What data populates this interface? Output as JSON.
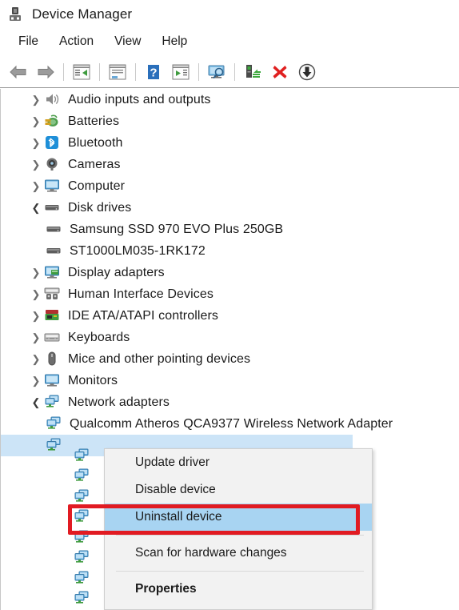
{
  "window": {
    "title": "Device Manager",
    "icon": "device-manager-icon"
  },
  "menubar": {
    "items": [
      {
        "label": "File",
        "name": "menu-file"
      },
      {
        "label": "Action",
        "name": "menu-action"
      },
      {
        "label": "View",
        "name": "menu-view"
      },
      {
        "label": "Help",
        "name": "menu-help"
      }
    ]
  },
  "toolbar": {
    "buttons": [
      {
        "name": "back-button",
        "icon": "back-arrow-icon"
      },
      {
        "name": "forward-button",
        "icon": "forward-arrow-icon"
      },
      {
        "name": "show-hide-console-tree-button",
        "icon": "console-tree-icon"
      },
      {
        "name": "properties-button",
        "icon": "properties-window-icon"
      },
      {
        "name": "help-button",
        "icon": "question-mark-icon"
      },
      {
        "name": "update-driver-button",
        "icon": "play-panel-icon"
      },
      {
        "name": "scan-for-hardware-changes-button",
        "icon": "monitor-scan-icon"
      },
      {
        "name": "add-legacy-hardware-button",
        "icon": "add-hardware-icon"
      },
      {
        "name": "uninstall-device-button",
        "icon": "red-x-icon"
      },
      {
        "name": "disable-device-button",
        "icon": "down-arrow-circle-icon"
      }
    ]
  },
  "tree": {
    "items": [
      {
        "label": "Audio inputs and outputs",
        "icon": "speaker-icon",
        "state": "collapsed",
        "level": 1
      },
      {
        "label": "Batteries",
        "icon": "battery-icon",
        "state": "collapsed",
        "level": 1
      },
      {
        "label": "Bluetooth",
        "icon": "bluetooth-icon",
        "state": "collapsed",
        "level": 1
      },
      {
        "label": "Cameras",
        "icon": "camera-icon",
        "state": "collapsed",
        "level": 1
      },
      {
        "label": "Computer",
        "icon": "computer-icon",
        "state": "collapsed",
        "level": 1
      },
      {
        "label": "Disk drives",
        "icon": "disk-drive-icon",
        "state": "expanded",
        "level": 1
      },
      {
        "label": "Samsung SSD 970 EVO Plus 250GB",
        "icon": "disk-drive-icon",
        "state": "leaf",
        "level": 2
      },
      {
        "label": "ST1000LM035-1RK172",
        "icon": "disk-drive-icon",
        "state": "leaf",
        "level": 2
      },
      {
        "label": "Display adapters",
        "icon": "display-adapter-icon",
        "state": "collapsed",
        "level": 1
      },
      {
        "label": "Human Interface Devices",
        "icon": "hid-icon",
        "state": "collapsed",
        "level": 1
      },
      {
        "label": "IDE ATA/ATAPI controllers",
        "icon": "ide-controller-icon",
        "state": "collapsed",
        "level": 1
      },
      {
        "label": "Keyboards",
        "icon": "keyboard-icon",
        "state": "collapsed",
        "level": 1
      },
      {
        "label": "Mice and other pointing devices",
        "icon": "mouse-icon",
        "state": "collapsed",
        "level": 1
      },
      {
        "label": "Monitors",
        "icon": "monitor-icon",
        "state": "collapsed",
        "level": 1
      },
      {
        "label": "Network adapters",
        "icon": "network-adapter-icon",
        "state": "expanded",
        "level": 1
      },
      {
        "label": "Qualcomm Atheros QCA9377 Wireless Network Adapter",
        "icon": "network-adapter-icon",
        "state": "leaf",
        "level": 2
      }
    ],
    "selected_row": {
      "label": "",
      "icon": "network-adapter-icon",
      "state": "leaf",
      "level": 2
    },
    "hidden_adapter_rows": 8
  },
  "context_menu": {
    "items": [
      {
        "label": "Update driver",
        "name": "context-update-driver",
        "type": "item"
      },
      {
        "label": "Disable device",
        "name": "context-disable-device",
        "type": "item"
      },
      {
        "label": "Uninstall device",
        "name": "context-uninstall-device",
        "type": "item",
        "highlighted": true
      },
      {
        "type": "separator"
      },
      {
        "label": "Scan for hardware changes",
        "name": "context-scan-for-hardware-changes",
        "type": "item"
      },
      {
        "type": "separator"
      },
      {
        "label": "Properties",
        "name": "context-properties",
        "type": "item",
        "bold": true
      }
    ]
  },
  "annotation": {
    "type": "red-rectangle-highlight",
    "target": "Uninstall device"
  },
  "colors": {
    "selection_blue": "#cce4f7",
    "menu_highlight_blue": "#a8d4f2",
    "annotation_red": "#e11b22",
    "menu_background": "#f2f2f2",
    "text": "#1b1b1b"
  }
}
